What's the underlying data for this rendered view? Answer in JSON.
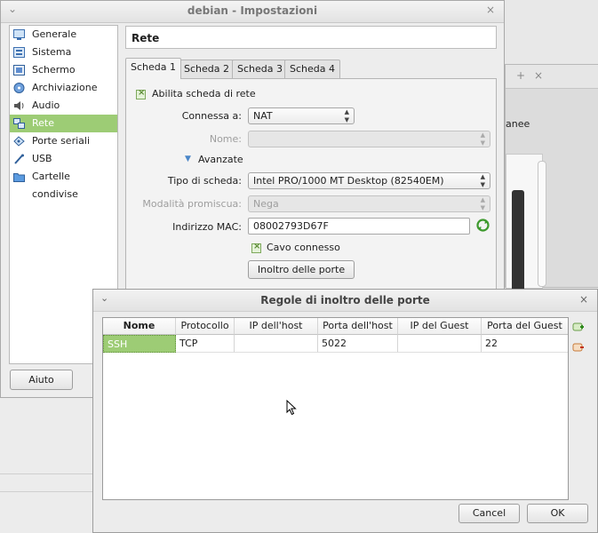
{
  "settings_window": {
    "title": "debian - Impostazioni",
    "sidebar": {
      "items": [
        {
          "label": "Generale",
          "icon": "general-icon"
        },
        {
          "label": "Sistema",
          "icon": "system-icon"
        },
        {
          "label": "Schermo",
          "icon": "display-icon"
        },
        {
          "label": "Archiviazione",
          "icon": "storage-icon"
        },
        {
          "label": "Audio",
          "icon": "audio-icon"
        },
        {
          "label": "Rete",
          "icon": "network-icon",
          "selected": true
        },
        {
          "label": "Porte seriali",
          "icon": "serial-ports-icon"
        },
        {
          "label": "USB",
          "icon": "usb-icon"
        },
        {
          "label": "Cartelle condivise",
          "icon": "shared-folders-icon"
        }
      ]
    },
    "help_button": "Aiuto",
    "page_title": "Rete",
    "tabs": [
      "Scheda 1",
      "Scheda 2",
      "Scheda 3",
      "Scheda 4"
    ],
    "enable_adapter_label": "Abilita scheda di rete",
    "attached_to_label": "Connessa a:",
    "attached_to_value": "NAT",
    "name_label": "Nome:",
    "name_value": "",
    "advanced_label": "Avanzate",
    "adapter_type_label": "Tipo di scheda:",
    "adapter_type_value": "Intel PRO/1000 MT Desktop (82540EM)",
    "promiscuous_label": "Modalità promiscua:",
    "promiscuous_value": "Nega",
    "mac_label": "Indirizzo MAC:",
    "mac_value": "08002793D67F",
    "cable_connected_label": "Cavo connesso",
    "port_forwarding_button": "Inoltro delle porte"
  },
  "background_window": {
    "partial_text": "anee",
    "controls": [
      "+",
      "×"
    ]
  },
  "port_forwarding_dialog": {
    "title": "Regole di inoltro delle porte",
    "columns": [
      "Nome",
      "Protocollo",
      "IP dell'host",
      "Porta dell'host",
      "IP del Guest",
      "Porta del Guest"
    ],
    "rows": [
      {
        "name": "SSH",
        "protocol": "TCP",
        "host_ip": "",
        "host_port": "5022",
        "guest_ip": "",
        "guest_port": "22"
      }
    ],
    "cancel_button": "Cancel",
    "ok_button": "OK"
  },
  "colors": {
    "selection": "#9dcc75",
    "accent_dark": "#5c8c36"
  }
}
